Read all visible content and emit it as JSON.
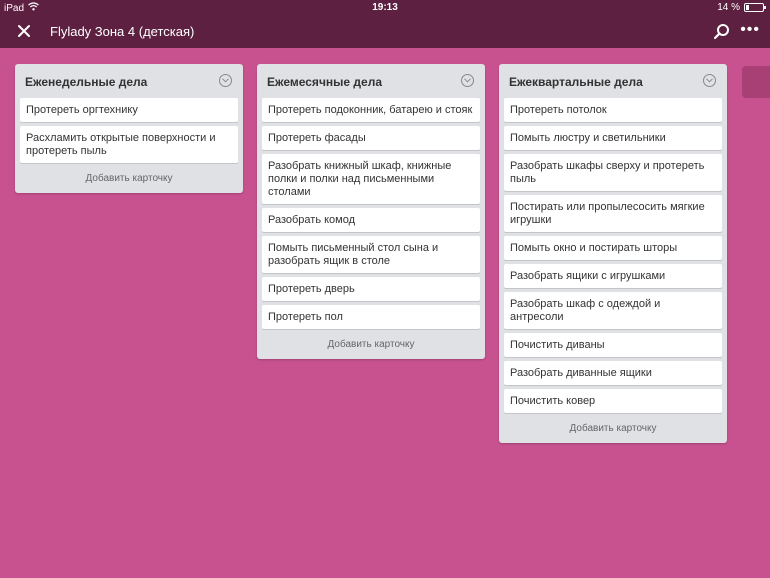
{
  "status_bar": {
    "device": "iPad",
    "time": "19:13",
    "battery": "14 %",
    "battery_level": 0.14
  },
  "header": {
    "title": "Flylady Зона 4 (детская)",
    "close_icon": "close-icon",
    "search_icon": "search-icon",
    "more_icon": "more-icon"
  },
  "colors": {
    "background": "#c8528f",
    "header": "#5d2040",
    "list": "#dfe1e5",
    "card": "#ffffff"
  },
  "lists": [
    {
      "title": "Еженедельные дела",
      "cards": [
        "Протереть оргтехнику",
        "Расхламить открытые поверхности и протереть пыль"
      ],
      "add_label": "Добавить карточку"
    },
    {
      "title": "Ежемесячные дела",
      "cards": [
        "Протереть подоконник, батарею и стояк",
        "Протереть фасады",
        "Разобрать книжный шкаф, книжные полки и полки над письменными столами",
        "Разобрать комод",
        "Помыть письменный стол сына и разобрать ящик в столе",
        "Протереть дверь",
        "Протереть пол"
      ],
      "add_label": "Добавить карточку"
    },
    {
      "title": "Ежеквартальные дела",
      "cards": [
        "Протереть потолок",
        "Помыть люстру и светильники",
        "Разобрать шкафы сверху и протереть пыль",
        "Постирать или пропылесосить мягкие игрушки",
        "Помыть окно и постирать шторы",
        "Разобрать ящики с игрушками",
        "Разобрать шкаф с одеждой и антресоли",
        "Почистить диваны",
        "Разобрать диванные ящики",
        "Почистить ковер"
      ],
      "add_label": "Добавить карточку"
    }
  ]
}
